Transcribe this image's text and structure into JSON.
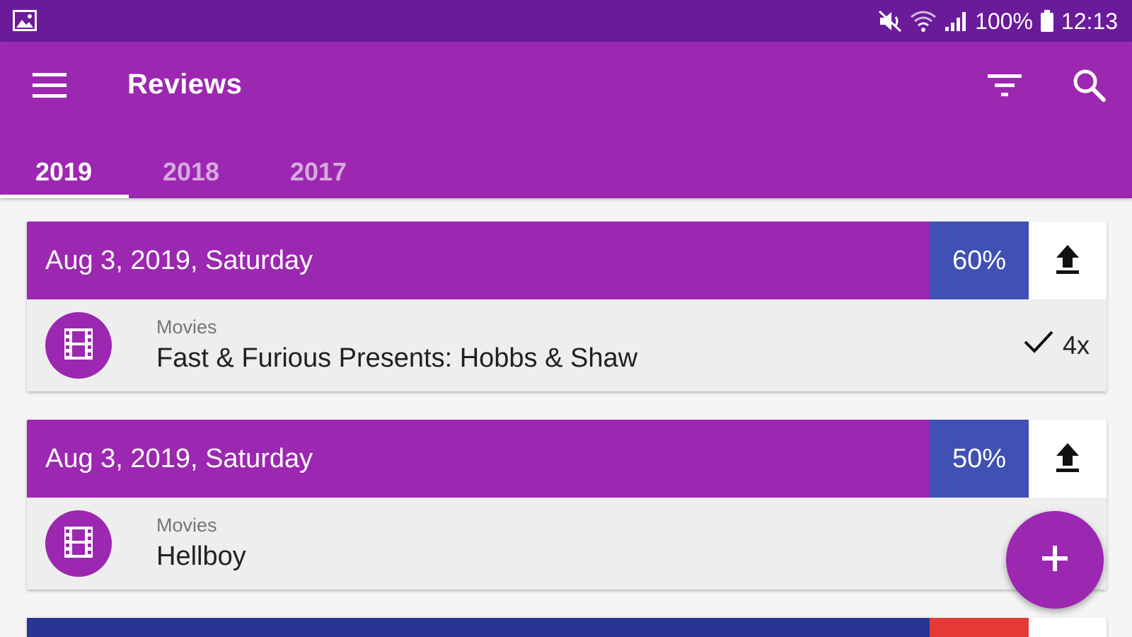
{
  "status_bar": {
    "icons": [
      "gallery-icon",
      "mute-icon",
      "wifi-icon",
      "signal-icon",
      "battery-icon"
    ],
    "battery": "100%",
    "time": "12:13"
  },
  "app_bar": {
    "title": "Reviews",
    "icons": [
      "menu-icon",
      "filter-icon",
      "search-icon"
    ]
  },
  "tabs": [
    {
      "label": "2019",
      "active": true
    },
    {
      "label": "2018",
      "active": false
    },
    {
      "label": "2017",
      "active": false
    }
  ],
  "reviews": [
    {
      "date": "Aug 3, 2019, Saturday",
      "percent": "60%",
      "category": "Movies",
      "title": "Fast & Furious Presents: Hobbs & Shaw",
      "watched_count": "4x",
      "colors": {
        "header": "#9c27b0",
        "percent": "#3f51b5"
      }
    },
    {
      "date": "Aug 3, 2019, Saturday",
      "percent": "50%",
      "category": "Movies",
      "title": "Hellboy",
      "colors": {
        "header": "#9c27b0",
        "percent": "#3f51b5"
      }
    }
  ],
  "partial_card": {
    "colors": {
      "header": "#283593",
      "percent": "#e53935"
    }
  },
  "colors": {
    "status_bar": "#6a1b9a",
    "primary": "#9c27b0",
    "accent": "#3f51b5"
  }
}
